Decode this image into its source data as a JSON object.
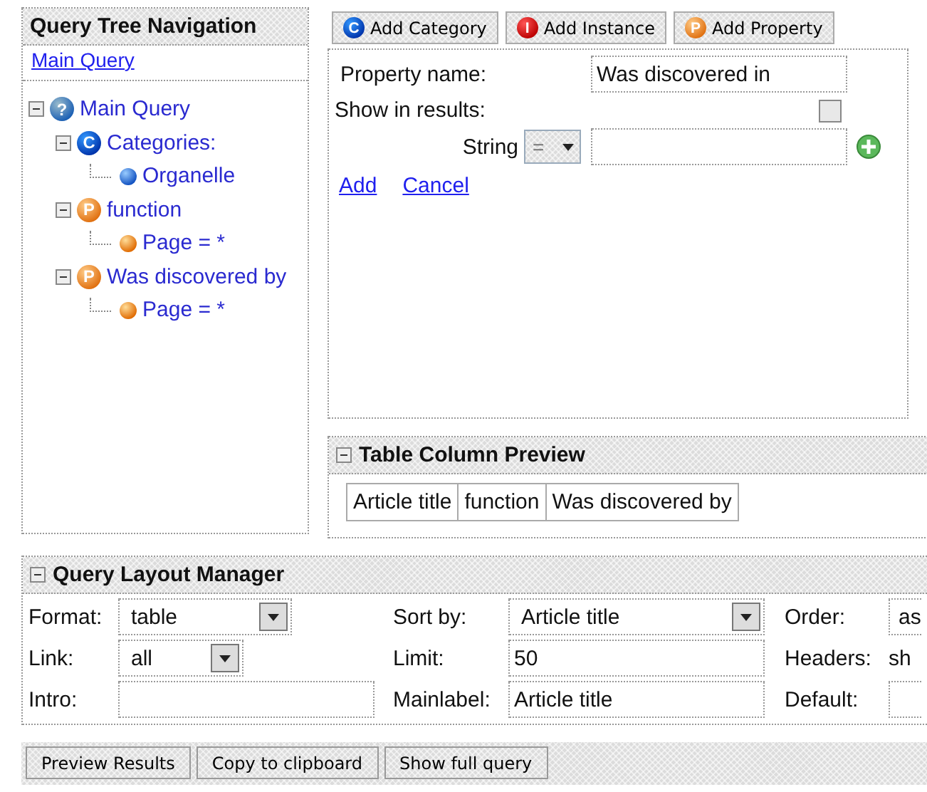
{
  "tree_panel": {
    "title": "Query Tree Navigation",
    "breadcrumb": "Main Query",
    "tree": [
      {
        "label": "Main Query",
        "kind": "query",
        "badge": "?",
        "expanded": true,
        "children": [
          {
            "label": "Categories:",
            "kind": "category",
            "badge": "C",
            "expanded": true,
            "children": [
              {
                "label": "Organelle",
                "kind": "ball"
              }
            ]
          },
          {
            "label": "function",
            "kind": "property",
            "badge": "P",
            "expanded": true,
            "children": [
              {
                "label": "Page = *",
                "kind": "ball-orange"
              }
            ]
          },
          {
            "label": "Was discovered by",
            "kind": "property",
            "badge": "P",
            "expanded": true,
            "children": [
              {
                "label": "Page = *",
                "kind": "ball-orange"
              }
            ]
          }
        ]
      }
    ]
  },
  "toolbar": [
    {
      "label": "Add Category",
      "kind": "category",
      "badge": "C"
    },
    {
      "label": "Add Instance",
      "kind": "instance",
      "badge": "I"
    },
    {
      "label": "Add Property",
      "kind": "property",
      "badge": "P"
    }
  ],
  "property_form": {
    "name_label": "Property name:",
    "name_value": "Was discovered in",
    "show_label": "Show in results:",
    "show_checked": false,
    "condition": {
      "type": "String",
      "operator": "="
    },
    "links": [
      "Add",
      "Cancel"
    ]
  },
  "table_preview": {
    "title": "Table Column Preview",
    "expanded": true,
    "columns": [
      "Article title",
      "function",
      "Was discovered by"
    ]
  },
  "layout_manager": {
    "title": "Query Layout Manager",
    "expanded": true,
    "rows": [
      [
        {
          "label": "Format:",
          "kind": "select",
          "value": "table"
        },
        {
          "label": "Sort by:",
          "kind": "select",
          "value": "Article title"
        },
        {
          "label": "Order:",
          "kind": "cut",
          "value": "as"
        }
      ],
      [
        {
          "label": "Link:",
          "kind": "select",
          "value": "all"
        },
        {
          "label": "Limit:",
          "kind": "text",
          "value": "50"
        },
        {
          "label": "Headers:",
          "kind": "plain",
          "value": "sh"
        }
      ],
      [
        {
          "label": "Intro:",
          "kind": "text"
        },
        {
          "label": "Mainlabel:",
          "kind": "text",
          "value": "Article title"
        },
        {
          "label": "Default:",
          "kind": "cut"
        }
      ]
    ]
  },
  "actions": [
    "Preview Results",
    "Copy to clipboard",
    "Show full query"
  ]
}
